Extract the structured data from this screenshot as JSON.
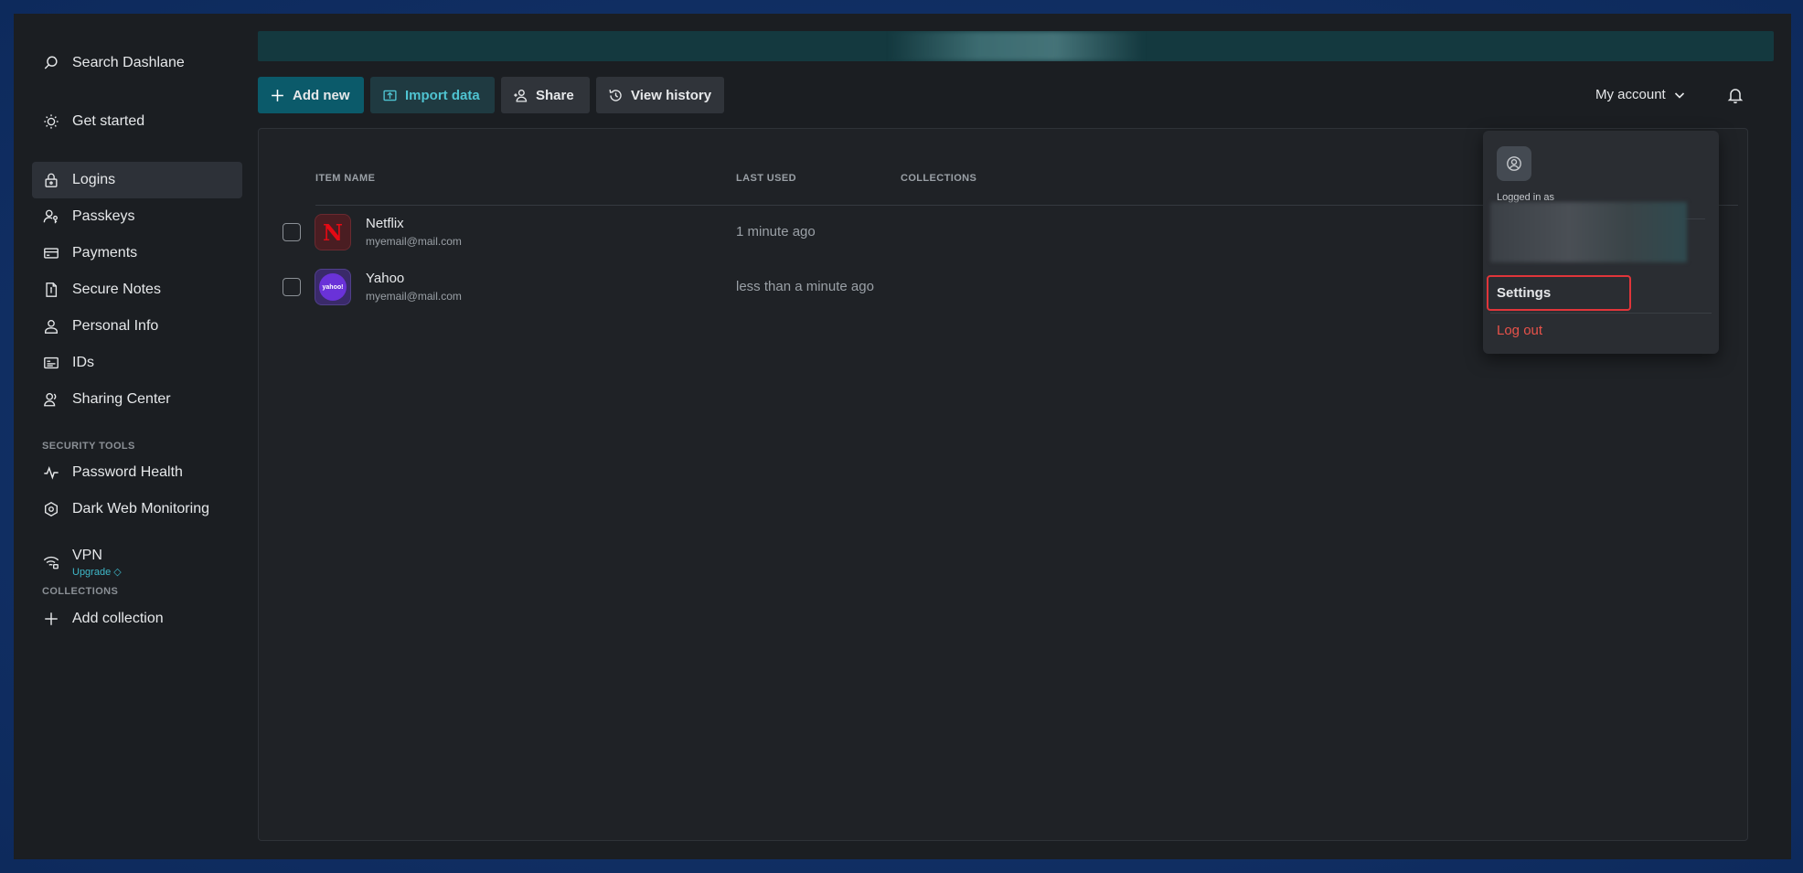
{
  "sidebar": {
    "search": "Search Dashlane",
    "get_started": "Get started",
    "items": [
      {
        "label": "Logins",
        "active": true
      },
      {
        "label": "Passkeys"
      },
      {
        "label": "Payments"
      },
      {
        "label": "Secure Notes"
      },
      {
        "label": "Personal Info"
      },
      {
        "label": "IDs"
      },
      {
        "label": "Sharing Center"
      }
    ],
    "security_tools_label": "SECURITY TOOLS",
    "security_items": [
      {
        "label": "Password Health"
      },
      {
        "label": "Dark Web Monitoring"
      },
      {
        "label": "VPN",
        "sub": "Upgrade"
      }
    ],
    "collections_label": "COLLECTIONS",
    "add_collection": "Add collection"
  },
  "toolbar": {
    "add_new": "Add new",
    "import_data": "Import data",
    "share": "Share",
    "view_history": "View history",
    "my_account": "My account"
  },
  "table": {
    "columns": [
      "ITEM NAME",
      "LAST USED",
      "COLLECTIONS"
    ],
    "rows": [
      {
        "name": "Netflix",
        "email": "myemail@mail.com",
        "last_used": "1 minute ago",
        "logo": "N"
      },
      {
        "name": "Yahoo",
        "email": "myemail@mail.com",
        "last_used": "less than a minute ago",
        "logo": "yahoo!"
      }
    ]
  },
  "account_menu": {
    "logged_in_as": "Logged in as",
    "settings": "Settings",
    "logout": "Log out"
  },
  "colors": {
    "accent": "#0b5a6a",
    "accent_text": "#4fc3d1",
    "danger": "#e8524a",
    "highlight_box": "#e0353a"
  }
}
